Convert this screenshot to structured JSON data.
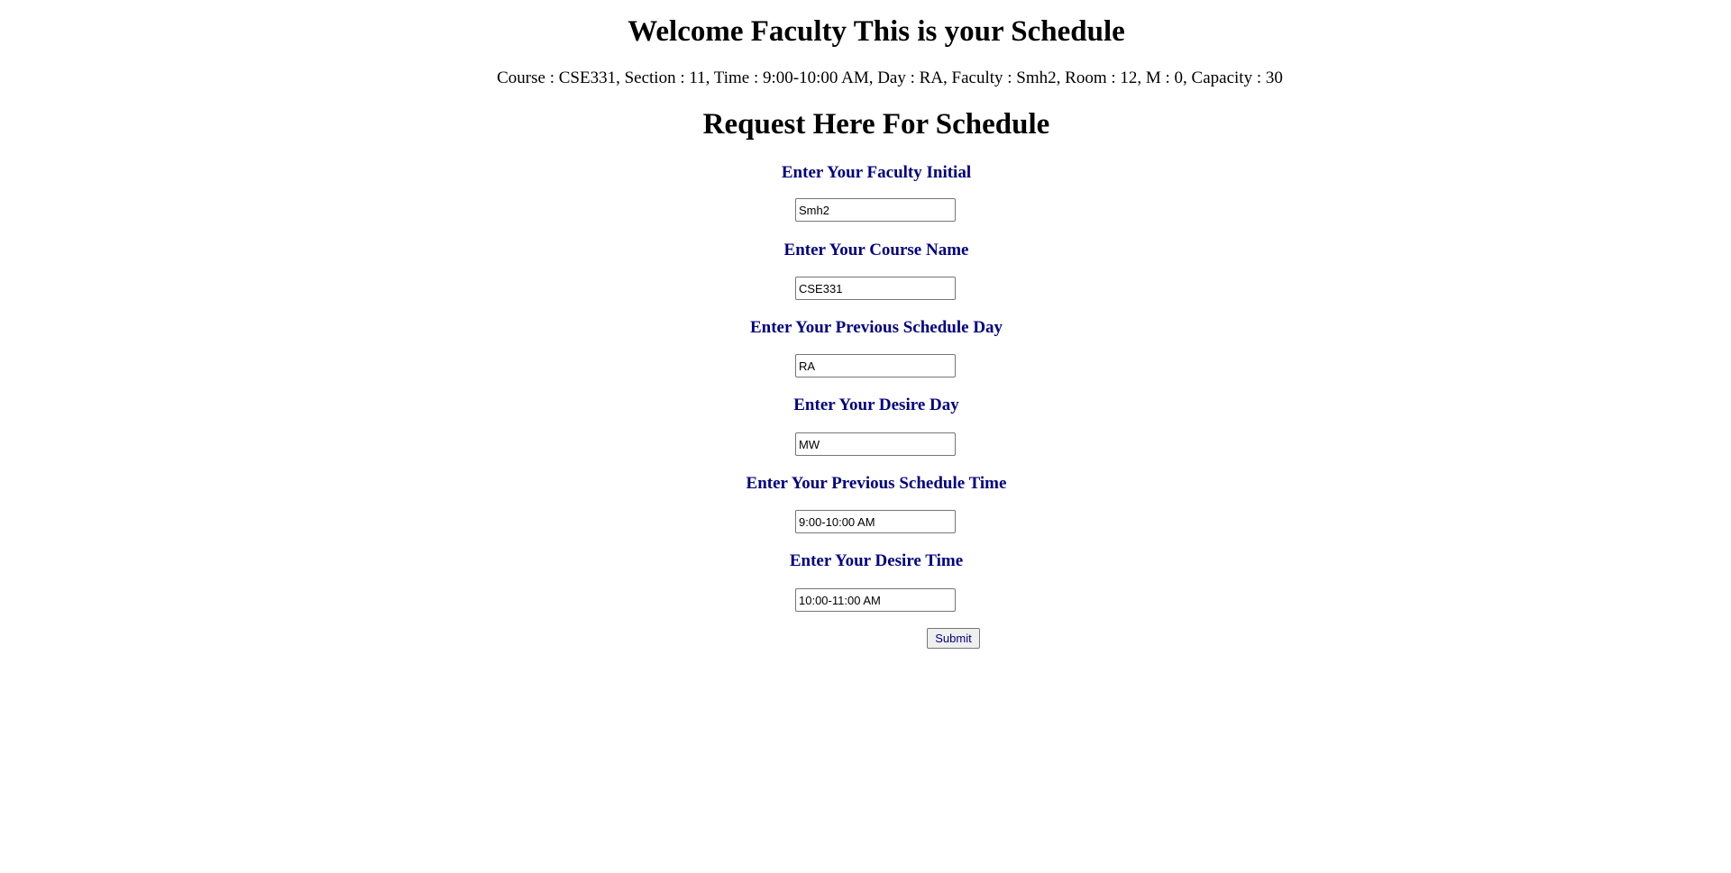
{
  "page": {
    "welcome_title": "Welcome Faculty This is your Schedule",
    "schedule_line": "Course : CSE331, Section : 11, Time : 9:00-10:00 AM, Day : RA, Faculty : Smh2, Room : 12, M : 0, Capacity : 30",
    "request_title": "Request Here For Schedule"
  },
  "form": {
    "fields": [
      {
        "label": "Enter Your Faculty Initial",
        "value": "Smh2"
      },
      {
        "label": "Enter Your Course Name",
        "value": "CSE331"
      },
      {
        "label": "Enter Your Previous Schedule Day",
        "value": "RA"
      },
      {
        "label": "Enter Your Desire Day",
        "value": "MW"
      },
      {
        "label": "Enter Your Previous Schedule Time",
        "value": "9:00-10:00 AM"
      },
      {
        "label": "Enter Your Desire Time",
        "value": "10:00-11:00 AM"
      }
    ],
    "submit_label": "Submit"
  },
  "colors": {
    "label_color": "#000080",
    "text_color": "#000000",
    "background": "#ffffff"
  }
}
